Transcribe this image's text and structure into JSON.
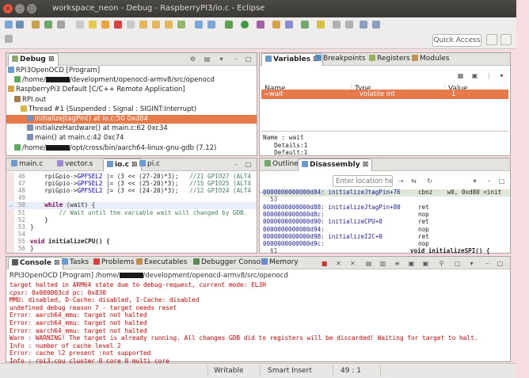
{
  "window": {
    "title": "workspace_neon - Debug - RaspberryPI3/io.c - Eclipse"
  },
  "toolbar": {
    "quick_access": "Quick Access"
  },
  "colors": {
    "selection": "#e8794a",
    "error_text": "#d00000",
    "keyword": "#7f0055",
    "comment": "#3f7f5f",
    "field": "#0000c0"
  },
  "debug_view": {
    "tab": "Debug",
    "tree": [
      {
        "text": "RPI3OpenOCD [Program]",
        "indent": 0,
        "icon": "program-icon"
      },
      {
        "text_before": "/home/",
        "text_after": "/development/openocd-armv8/src/openocd",
        "indent": 1,
        "icon": "process-icon",
        "redacted": true
      },
      {
        "text": "RaspberryPi3 Default [C/C++ Remote Application]",
        "indent": 0,
        "icon": "cdt-launch-icon"
      },
      {
        "text": "RPI.out",
        "indent": 1,
        "icon": "target-icon"
      },
      {
        "text": "Thread #1 (Suspended : Signal : SIGINT:Interrupt)",
        "indent": 2,
        "icon": "thread-icon"
      },
      {
        "text": "initializeJtagPin() at io.c:50 0xd84",
        "indent": 3,
        "icon": "stack-frame-icon",
        "selected": true
      },
      {
        "text": "initializeHardware() at main.c:62 0xc34",
        "indent": 3,
        "icon": "stack-frame-icon"
      },
      {
        "text": "main() at main.c:42 0xc74",
        "indent": 3,
        "icon": "stack-frame-icon"
      },
      {
        "text_before": "/home/",
        "text_after": "/opt/cross/bin/aarch64-linux-gnu-gdb (7.12)",
        "indent": 1,
        "icon": "gdb-icon",
        "redacted": true
      }
    ]
  },
  "variables_view": {
    "tabs": [
      "Variables",
      "Breakpoints",
      "Registers",
      "Modules"
    ],
    "columns": [
      "Name",
      "Type",
      "Value"
    ],
    "rows": [
      {
        "name": "wait",
        "type": "volatile int",
        "value": "1"
      }
    ],
    "details": [
      "Name : wait",
      "   Details:1",
      "   Default:1"
    ]
  },
  "editor": {
    "tabs": [
      "main.c",
      "vector.s",
      "io.c",
      "pi.c"
    ],
    "active_tab": 2,
    "lines": [
      {
        "num": "46",
        "pre": "    rpiGpio->",
        "field": "GPFSEL2",
        "post": " |= (3 << (27-20)*3);   ",
        "comment": "//21 GPIO27 (ALT4"
      },
      {
        "num": "47",
        "pre": "    rpiGpio->",
        "field": "GPFSEL2",
        "post": " |= (3 << (25-20)*3);   ",
        "comment": "//15 GPIO25 (ALT4"
      },
      {
        "num": "48",
        "pre": "    rpiGpio->",
        "field": "GPFSEL2",
        "post": " |= (3 << (24-20)*3);   ",
        "comment": "//12 GPIO24 (ALT4"
      },
      {
        "num": "49",
        "pre": "",
        "field": "",
        "post": "",
        "comment": ""
      },
      {
        "num": "50",
        "kw": "while",
        "pre": "    ",
        "post": " (wait) {",
        "highlight": true
      },
      {
        "num": "51",
        "pre": "        ",
        "comment": "// Wait until the variable wait will changed by GDB."
      },
      {
        "num": "52",
        "pre": "    }"
      },
      {
        "num": "53",
        "pre": "}"
      },
      {
        "num": "54",
        "pre": ""
      },
      {
        "num": "55",
        "kw": "void",
        "pre": "",
        "post": " initializeCPU() {",
        "bold_post": true
      },
      {
        "num": "56",
        "pre": "}"
      }
    ]
  },
  "disassembly_view": {
    "tabs": [
      "Outline",
      "Disassembly"
    ],
    "location_placeholder": "Enter location here",
    "lines": [
      {
        "text": "0000000000000d84: initializeJtagPin+76",
        "right": "cbnz    w0, 0xd80 <init",
        "current": true
      },
      {
        "text": "  53"
      },
      {
        "text": "0000000000000d88: initializeJtagPin+80",
        "right": "ret"
      },
      {
        "text": "0000000000000d8c:",
        "right": "nop"
      },
      {
        "text": "0000000000000d90: initializeCPU+0",
        "right": "ret"
      },
      {
        "text": "0000000000000d94:",
        "right": "nop"
      },
      {
        "text": "0000000000000d98: initializeI2C+0",
        "right": "ret"
      },
      {
        "text": "0000000000000d9c:",
        "right": "nop"
      },
      {
        "text": "  61",
        "right": "void initializeSPI() {",
        "right_bold": true
      }
    ]
  },
  "console_view": {
    "tabs": [
      "Console",
      "Tasks",
      "Problems",
      "Executables",
      "Debugger Console",
      "Memory"
    ],
    "header_before": "RPI3OpenOCD [Program] /home/",
    "header_after": "/development/openocd-armv8/src/openocd",
    "lines": [
      "target halted in ARM64 state due to debug-request, current mode: EL3H",
      "cpsr: 0x000003cd pc: 0x830",
      "MMU: disabled, D-Cache: disabled, I-Cache: disabled",
      "undefined debug reason 7 - target needs reset",
      "Error: aarch64_mmu: target not halted",
      "Error: aarch64_mmu: target not halted",
      "Error: aarch64_mmu: target not halted",
      "Warn : WARNING! The target is already running. All changes GDB did to registers will be discarded! Waiting for target to halt.",
      "Info : number of cache level 2",
      "Error: cache l2 present :not supported",
      "Info : rpi3.cpu cluster 0 core 0 multi core"
    ]
  },
  "statusbar": {
    "mode": "Writable",
    "insert": "Smart Insert",
    "position": "49 : 1"
  }
}
